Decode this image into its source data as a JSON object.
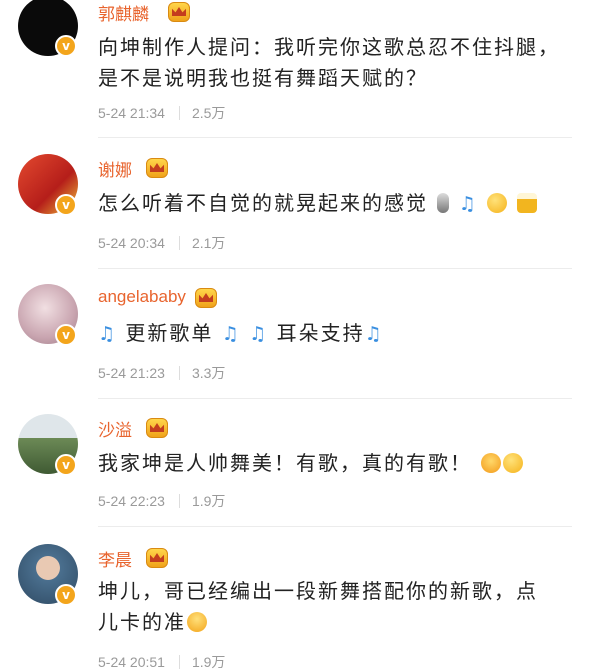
{
  "comments": [
    {
      "name": "郭麒麟",
      "text": "向坤制作人提问：我听完你这歌总忍不住抖腿，是不是说明我也挺有舞蹈天赋的？",
      "time": "5-24 21:34",
      "likes": "2.5万",
      "avatar_color": "#0a0a0a"
    },
    {
      "name": "谢娜",
      "text": "怎么听着不自觉的就晃起来的感觉",
      "time": "5-24 20:34",
      "likes": "2.1万",
      "avatar_color": "#d9362b"
    },
    {
      "name": "angelababy",
      "text_parts": [
        "更新歌单",
        "耳朵支持"
      ],
      "time": "5-24 21:23",
      "likes": "3.3万",
      "avatar_color": "#d8c2c8"
    },
    {
      "name": "沙溢",
      "text": "我家坤是人帅舞美！有歌，真的有歌！",
      "time": "5-24 22:23",
      "likes": "1.9万",
      "avatar_color": "#5f7a4e"
    },
    {
      "name": "李晨",
      "text": "坤儿，哥已经编出一段新舞搭配你的新歌，点儿卡的准",
      "time": "5-24 20:51",
      "likes": "1.9万",
      "avatar_color": "#4a6f8e"
    }
  ],
  "badge_letter": "v",
  "colors": {
    "name": "#e8642e",
    "badge": "#f3a51c",
    "music_note": "#3a8fe0"
  }
}
